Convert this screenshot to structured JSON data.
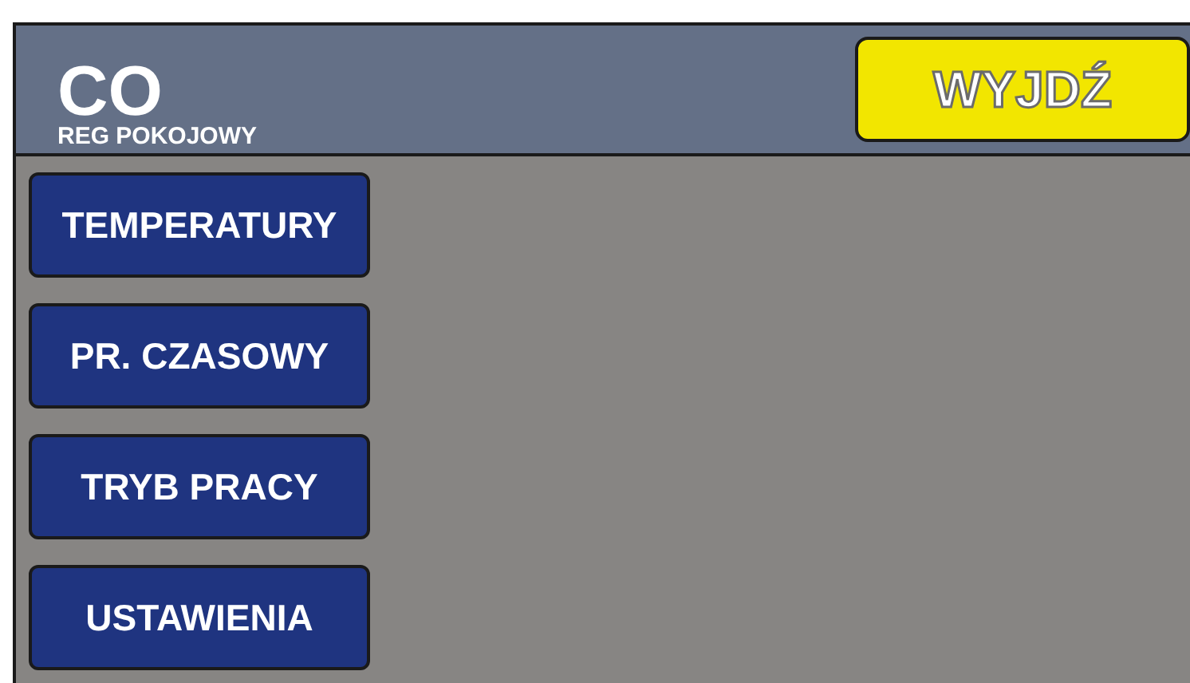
{
  "header": {
    "title": "CO",
    "subtitle": "REG POKOJOWY",
    "exit_button": "WYJDŹ"
  },
  "menu": [
    {
      "label": "TEMPERATURY"
    },
    {
      "label": "PR. CZASOWY"
    },
    {
      "label": "TRYB PRACY"
    },
    {
      "label": "USTAWIENIA"
    }
  ]
}
